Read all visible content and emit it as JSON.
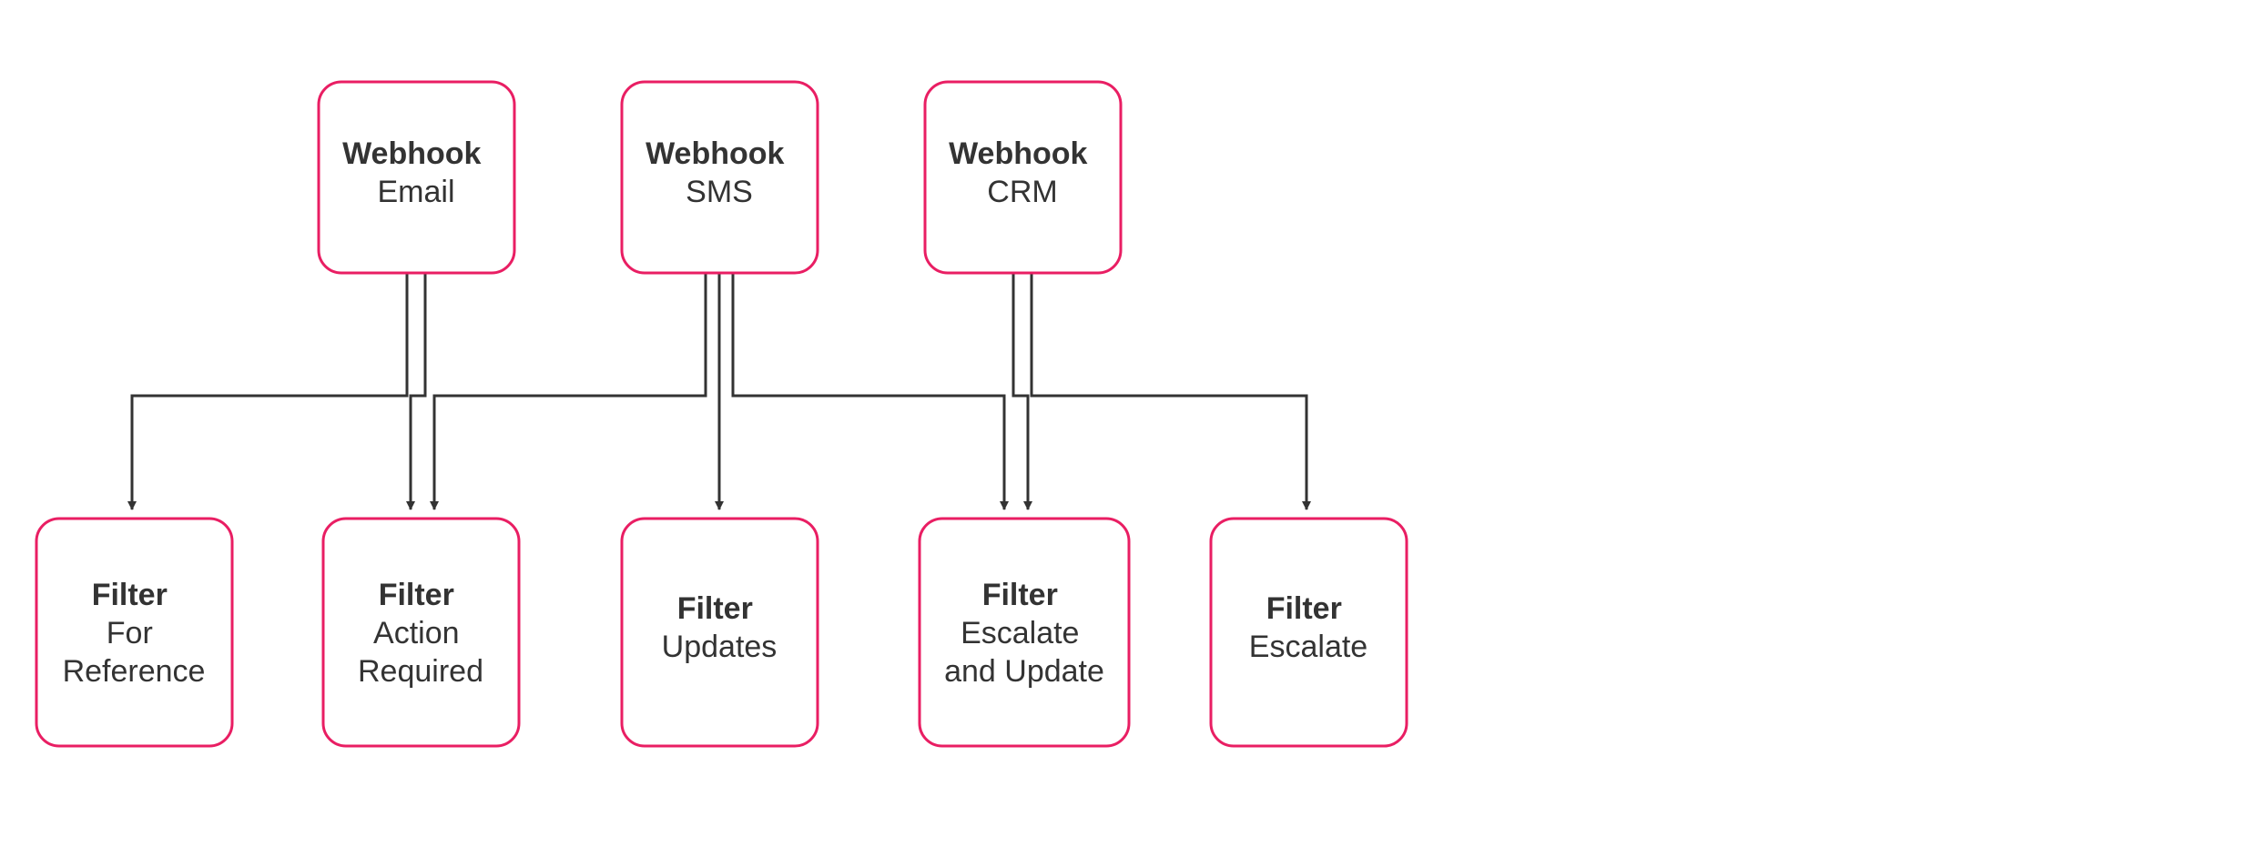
{
  "diagram": {
    "accent": "#e91e63",
    "node_border": "#e91e63",
    "edge_color": "#333333",
    "top_nodes": [
      {
        "id": "wh-email",
        "title": "Webhook",
        "subtitle": "Email"
      },
      {
        "id": "wh-sms",
        "title": "Webhook",
        "subtitle": "SMS"
      },
      {
        "id": "wh-crm",
        "title": "Webhook",
        "subtitle": "CRM"
      }
    ],
    "bottom_nodes": [
      {
        "id": "f-ref",
        "title": "Filter",
        "subtitle": "For\nReference"
      },
      {
        "id": "f-action",
        "title": "Filter",
        "subtitle": "Action\nRequired"
      },
      {
        "id": "f-updates",
        "title": "Filter",
        "subtitle": "Updates"
      },
      {
        "id": "f-escupd",
        "title": "Filter",
        "subtitle": "Escalate\nand Update"
      },
      {
        "id": "f-escalate",
        "title": "Filter",
        "subtitle": "Escalate"
      }
    ],
    "edges": [
      {
        "from": "wh-email",
        "to": "f-ref"
      },
      {
        "from": "wh-email",
        "to": "f-action"
      },
      {
        "from": "wh-sms",
        "to": "f-action"
      },
      {
        "from": "wh-sms",
        "to": "f-updates"
      },
      {
        "from": "wh-sms",
        "to": "f-escupd"
      },
      {
        "from": "wh-crm",
        "to": "f-escupd"
      },
      {
        "from": "wh-crm",
        "to": "f-escalate"
      }
    ]
  }
}
